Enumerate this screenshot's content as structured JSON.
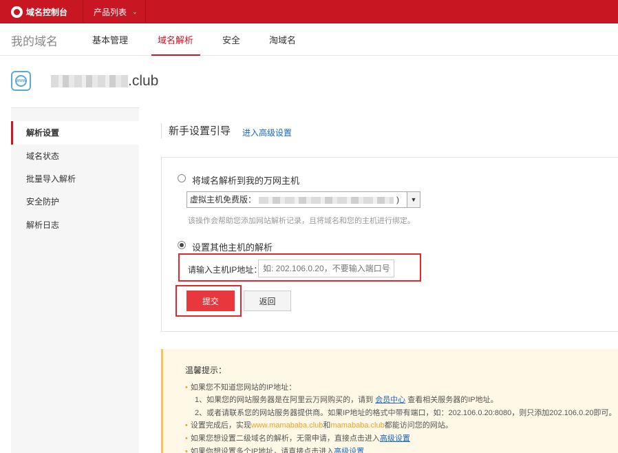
{
  "topbar": {
    "brand": "域名控制台",
    "product_menu": "产品列表"
  },
  "nav": {
    "title": "我的域名",
    "tabs": [
      "基本管理",
      "域名解析",
      "安全",
      "淘域名"
    ],
    "active_tab": "域名解析"
  },
  "domain": {
    "name_suffix": ".club",
    "icon_text": "WWW"
  },
  "sidebar": {
    "items": [
      "解析设置",
      "域名状态",
      "批量导入解析",
      "安全防护",
      "解析日志"
    ]
  },
  "content": {
    "title": "新手设置引导",
    "advanced_link": "进入高级设置",
    "option1_label": "将域名解析到我的万网主机",
    "host_select_prefix": "虚拟主机免费版：",
    "host_select_suffix": ")",
    "hint": "该操作会帮助您添加网站解析记录，且将域名和您的主机进行绑定。",
    "option2_label": "设置其他主机的解析",
    "ip_label": "请输入主机IP地址：",
    "ip_placeholder": "如: 202.106.0.20，不要输入端口号",
    "submit_label": "提交",
    "back_label": "返回"
  },
  "tips": {
    "title": "温馨提示：",
    "l1": "如果您不知道您网站的IP地址：",
    "l2a": "1、如果您的网站服务器是在阿里云万网购买的，请到",
    "l2_link": "会员中心",
    "l2b": "查看相关服务器的IP地址。",
    "l3": "2、或者请联系您的网站服务器提供商。如果IP地址的格式中带有端口，如：202.106.0.20:8080，则只添加202.106.0.20即可。",
    "l4a": "设置完成后，实现",
    "l4_d1": "www.mamababa.club",
    "l4b": "和",
    "l4_d2": "mamababa.club",
    "l4c": "都能访问您的网站。",
    "l5a": "如果您想设置二级域名的解析，无需申请，直接点击进入",
    "l5_link": "高级设置",
    "l6a": "如果你想设置多个IP地址，请直接点击进入",
    "l6_link": "高级设置"
  },
  "colors": {
    "brand_red": "#c81623",
    "link_blue": "#1a66c8",
    "tip_orange": "#f0a020"
  }
}
